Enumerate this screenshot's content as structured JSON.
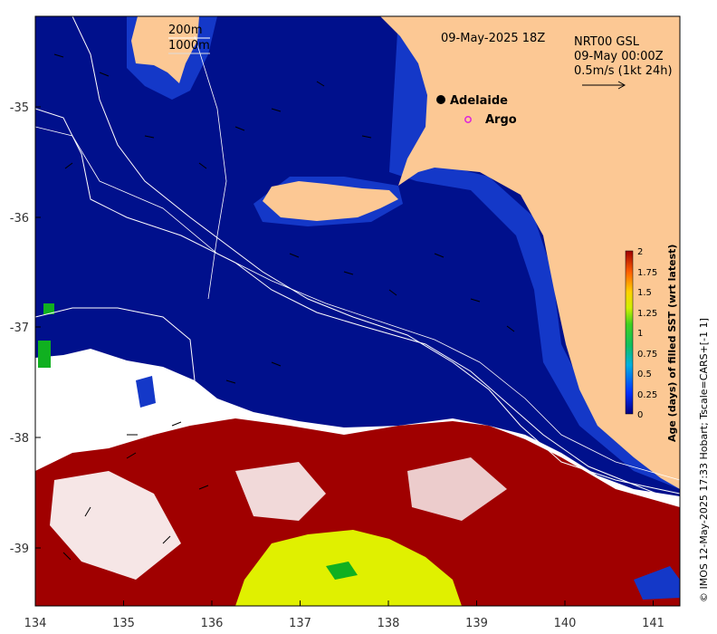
{
  "header": {
    "datetime": "09-May-2025 18Z",
    "product": "NRT00 GSL",
    "product_time": "09-May 00:00Z",
    "vector_scale": "0.5m/s (1kt 24h)"
  },
  "isobaths": {
    "contour_1": "200m",
    "contour_2": "1000m"
  },
  "places": [
    {
      "label": "Adelaide",
      "marker": "filled-dot",
      "color": "#000000"
    },
    {
      "label": "Argo",
      "marker": "hollow-circle",
      "color": "#dd22dd"
    }
  ],
  "axes": {
    "x_ticks": [
      "134",
      "135",
      "136",
      "137",
      "138",
      "139",
      "140",
      "141"
    ],
    "y_ticks": [
      "-35",
      "-36",
      "-37",
      "-38",
      "-39"
    ]
  },
  "colorbar": {
    "title": "Age (days) of filled SST (wrt latest)",
    "ticks": [
      "0",
      "0.25",
      "0.5",
      "0.75",
      "1",
      "1.25",
      "1.5",
      "1.75",
      "2"
    ],
    "range": [
      0,
      2
    ]
  },
  "credit": "© IMOS 12-May-2025 17:33 Hobart; Tscale=CARS+[-1 1]",
  "colors": {
    "ocean": "#00108c",
    "ocean_dark": "#000a6e",
    "shelf": "#1438c8",
    "land": "#fcc894",
    "old_sst": "#a00000",
    "no_data": "#ffffff",
    "young_yellow": "#e0f000",
    "green": "#10b020"
  }
}
